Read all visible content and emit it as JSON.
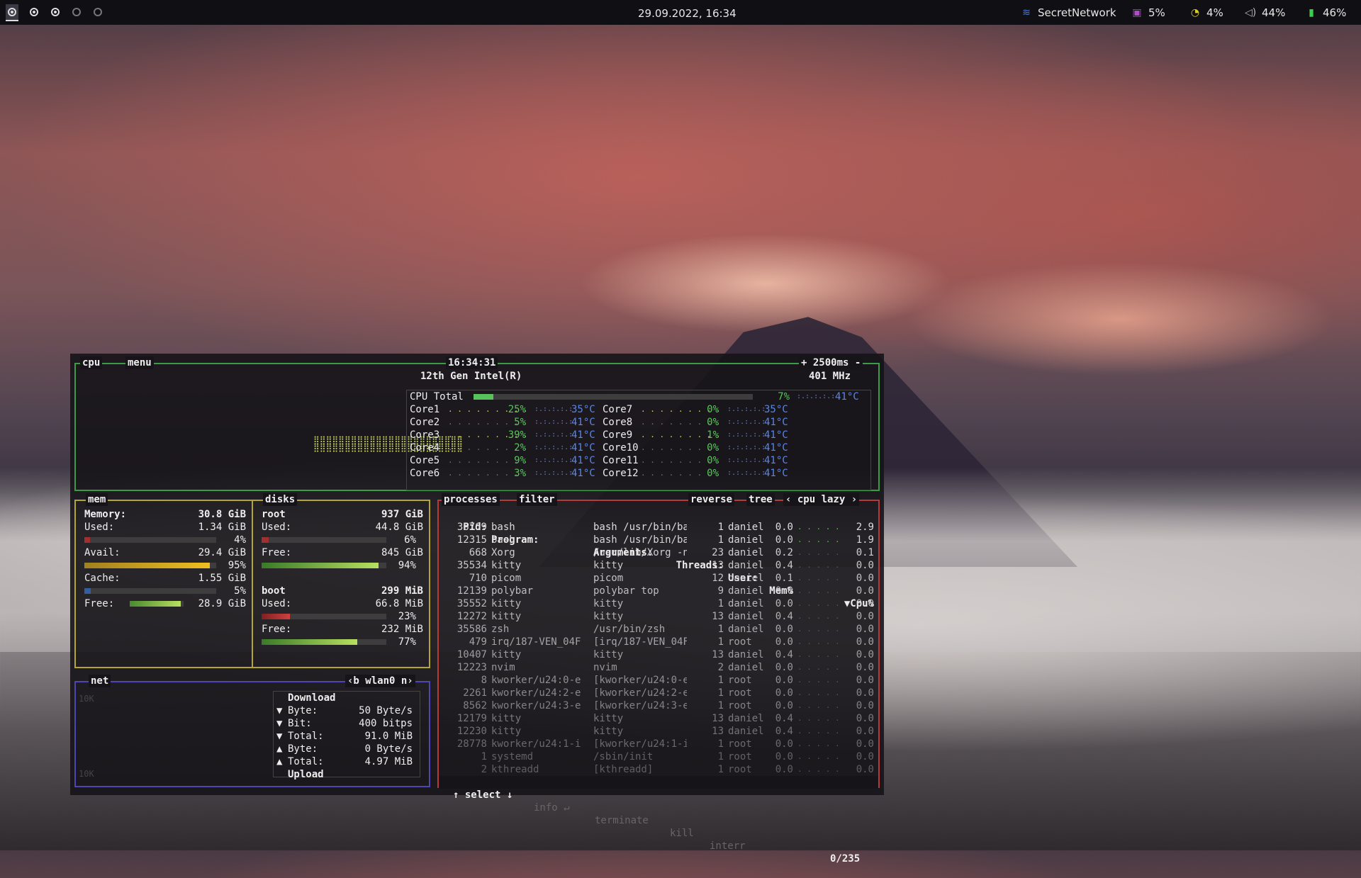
{
  "topbar": {
    "clock": "29.09.2022, 16:34",
    "wifi": "SecretNetwork",
    "cpu_pct": "5%",
    "mem_pct": "4%",
    "volume": "44%",
    "battery": "46%",
    "icons": [
      "workspace-ring-icon",
      "wifi-icon",
      "cpu-icon",
      "pie-icon",
      "speaker-icon",
      "battery-icon"
    ]
  },
  "cpu": {
    "title": "cpu",
    "menu": "menu",
    "time": "16:34:31",
    "interval": "+ 2500ms -",
    "model": "12th Gen Intel(R)",
    "freq": "401 MHz",
    "total_label": "CPU Total",
    "total_pct": "7%",
    "total_temp": "41°C",
    "cores_left": [
      {
        "name": "Core1",
        "pct": "25%",
        "temp": "35°C"
      },
      {
        "name": "Core2",
        "pct": "5%",
        "temp": "41°C"
      },
      {
        "name": "Core3",
        "pct": "39%",
        "temp": "41°C"
      },
      {
        "name": "Core4",
        "pct": "2%",
        "temp": "41°C"
      },
      {
        "name": "Core5",
        "pct": "9%",
        "temp": "41°C"
      },
      {
        "name": "Core6",
        "pct": "3%",
        "temp": "41°C"
      }
    ],
    "cores_right": [
      {
        "name": "Core7",
        "pct": "0%",
        "temp": "35°C"
      },
      {
        "name": "Core8",
        "pct": "0%",
        "temp": "41°C"
      },
      {
        "name": "Core9",
        "pct": "1%",
        "temp": "41°C"
      },
      {
        "name": "Core10",
        "pct": "0%",
        "temp": "41°C"
      },
      {
        "name": "Core11",
        "pct": "0%",
        "temp": "41°C"
      },
      {
        "name": "Core12",
        "pct": "0%",
        "temp": "41°C"
      }
    ]
  },
  "mem": {
    "title": "mem",
    "memory_label": "Memory:",
    "memory_val": "30.8 GiB",
    "used_label": "Used:",
    "used_val": "1.34 GiB",
    "used_pct": "4%",
    "avail_label": "Avail:",
    "avail_val": "29.4 GiB",
    "avail_pct": "95%",
    "cache_label": "Cache:",
    "cache_val": "1.55 GiB",
    "cache_pct": "5%",
    "free_label": "Free:",
    "free_val": "28.9 GiB"
  },
  "disks": {
    "title": "disks",
    "root_label": "root",
    "root_size": "937 GiB",
    "root_used_label": "Used:",
    "root_used_val": "44.8 GiB",
    "root_used_pct": "6%",
    "root_free_label": "Free:",
    "root_free_val": "845 GiB",
    "root_free_pct": "94%",
    "boot_label": "boot",
    "boot_size": "299 MiB",
    "boot_used_label": "Used:",
    "boot_used_val": "66.8 MiB",
    "boot_used_pct": "23%",
    "boot_free_label": "Free:",
    "boot_free_val": "232 MiB",
    "boot_free_pct": "77%"
  },
  "net": {
    "title": "net",
    "iface": "‹b wlan0 n›",
    "scale_top": "10K",
    "scale_bottom": "10K",
    "download_label": "Download",
    "upload_label": "Upload",
    "rows": [
      {
        "arrow": "▼",
        "label": "Byte:",
        "val": "50 Byte/s"
      },
      {
        "arrow": "▼",
        "label": "Bit:",
        "val": "400 bitps"
      },
      {
        "arrow": "▼",
        "label": "Total:",
        "val": "91.0 MiB"
      },
      {
        "arrow": "▲",
        "label": "Byte:",
        "val": "0 Byte/s"
      },
      {
        "arrow": "▲",
        "label": "Total:",
        "val": "4.97 MiB"
      }
    ]
  },
  "proc": {
    "title": "processes",
    "filter": "filter",
    "reverse": "reverse",
    "tree": "tree",
    "sort": "‹ cpu lazy ›",
    "headers": {
      "pid": "Pid:",
      "program": "Program:",
      "args": "Arguments:",
      "threads": "Threads:",
      "user": "User:",
      "mem": "Mem%",
      "cpu": "▼Cpu%"
    },
    "rows": [
      {
        "pid": "36769",
        "program": "bash",
        "args": "bash /usr/bin/ba",
        "threads": "1",
        "user": "daniel",
        "mem": "0.0",
        "cpu": "2.9"
      },
      {
        "pid": "12315",
        "program": "bash",
        "args": "bash /usr/bin/ba",
        "threads": "1",
        "user": "daniel",
        "mem": "0.0",
        "cpu": "1.9"
      },
      {
        "pid": "668",
        "program": "Xorg",
        "args": "/usr/lib/Xorg -n",
        "threads": "23",
        "user": "daniel",
        "mem": "0.2",
        "cpu": "0.1"
      },
      {
        "pid": "35534",
        "program": "kitty",
        "args": "kitty",
        "threads": "13",
        "user": "daniel",
        "mem": "0.4",
        "cpu": "0.0"
      },
      {
        "pid": "710",
        "program": "picom",
        "args": "picom",
        "threads": "12",
        "user": "daniel",
        "mem": "0.1",
        "cpu": "0.0"
      },
      {
        "pid": "12139",
        "program": "polybar",
        "args": "polybar top",
        "threads": "9",
        "user": "daniel",
        "mem": "0.0",
        "cpu": "0.0"
      },
      {
        "pid": "35552",
        "program": "kitty",
        "args": "kitty",
        "threads": "1",
        "user": "daniel",
        "mem": "0.0",
        "cpu": "0.0"
      },
      {
        "pid": "12272",
        "program": "kitty",
        "args": "kitty",
        "threads": "13",
        "user": "daniel",
        "mem": "0.4",
        "cpu": "0.0"
      },
      {
        "pid": "35586",
        "program": "zsh",
        "args": "/usr/bin/zsh",
        "threads": "1",
        "user": "daniel",
        "mem": "0.0",
        "cpu": "0.0"
      },
      {
        "pid": "479",
        "program": "irq/187-VEN_04F",
        "args": "[irq/187-VEN_04F",
        "threads": "1",
        "user": "root",
        "mem": "0.0",
        "cpu": "0.0"
      },
      {
        "pid": "10407",
        "program": "kitty",
        "args": "kitty",
        "threads": "13",
        "user": "daniel",
        "mem": "0.4",
        "cpu": "0.0"
      },
      {
        "pid": "12223",
        "program": "nvim",
        "args": "nvim",
        "threads": "2",
        "user": "daniel",
        "mem": "0.0",
        "cpu": "0.0"
      },
      {
        "pid": "8",
        "program": "kworker/u24:0-e",
        "args": "[kworker/u24:0-e",
        "threads": "1",
        "user": "root",
        "mem": "0.0",
        "cpu": "0.0"
      },
      {
        "pid": "2261",
        "program": "kworker/u24:2-e",
        "args": "[kworker/u24:2-e",
        "threads": "1",
        "user": "root",
        "mem": "0.0",
        "cpu": "0.0"
      },
      {
        "pid": "8562",
        "program": "kworker/u24:3-e",
        "args": "[kworker/u24:3-e",
        "threads": "1",
        "user": "root",
        "mem": "0.0",
        "cpu": "0.0"
      },
      {
        "pid": "12179",
        "program": "kitty",
        "args": "kitty",
        "threads": "13",
        "user": "daniel",
        "mem": "0.4",
        "cpu": "0.0"
      },
      {
        "pid": "12230",
        "program": "kitty",
        "args": "kitty",
        "threads": "13",
        "user": "daniel",
        "mem": "0.4",
        "cpu": "0.0"
      },
      {
        "pid": "28778",
        "program": "kworker/u24:1-i",
        "args": "[kworker/u24:1-i",
        "threads": "1",
        "user": "root",
        "mem": "0.0",
        "cpu": "0.0"
      },
      {
        "pid": "1",
        "program": "systemd",
        "args": "/sbin/init",
        "threads": "1",
        "user": "root",
        "mem": "0.0",
        "cpu": "0.0"
      },
      {
        "pid": "2",
        "program": "kthreadd",
        "args": "[kthreadd]",
        "threads": "1",
        "user": "root",
        "mem": "0.0",
        "cpu": "0.0"
      }
    ],
    "footer": {
      "select": "↑ select ↓",
      "info": "info ↵",
      "terminate": "terminate",
      "kill": "kill",
      "interr": "interr",
      "count": "0/235"
    }
  }
}
